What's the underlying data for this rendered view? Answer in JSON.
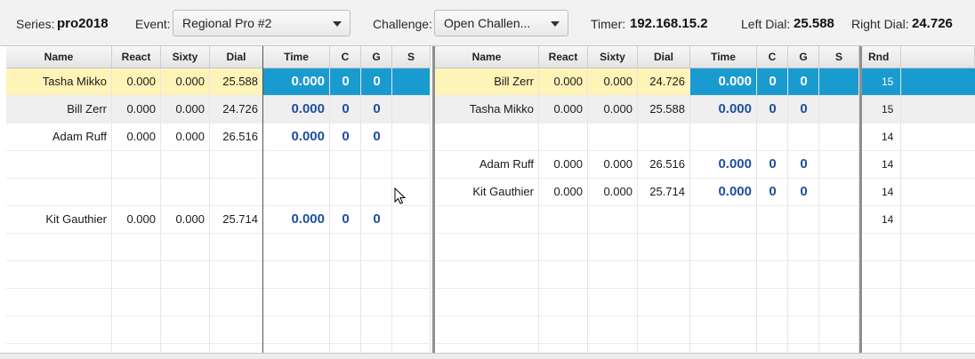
{
  "topbar": {
    "series_label": "Series:",
    "series_value": "pro2018",
    "event_label": "Event:",
    "event_value": "Regional Pro #2",
    "challenge_label": "Challenge:",
    "challenge_value": "Open Challen...",
    "timer_label": "Timer:",
    "timer_value": "192.168.15.2",
    "left_dial_label": "Left Dial:",
    "left_dial_value": "25.588",
    "right_dial_label": "Right Dial:",
    "right_dial_value": "24.726"
  },
  "left_table": {
    "headers": [
      "Name",
      "React",
      "Sixty",
      "Dial",
      "Time",
      "C",
      "G",
      "S"
    ],
    "rows": [
      {
        "name": "Tasha Mikko",
        "react": "0.000",
        "sixty": "0.000",
        "dial": "25.588",
        "time": "0.000",
        "c": "0",
        "g": "0",
        "s": ""
      },
      {
        "name": "Bill Zerr",
        "react": "0.000",
        "sixty": "0.000",
        "dial": "24.726",
        "time": "0.000",
        "c": "0",
        "g": "0",
        "s": ""
      },
      {
        "name": "Adam Ruff",
        "react": "0.000",
        "sixty": "0.000",
        "dial": "26.516",
        "time": "0.000",
        "c": "0",
        "g": "0",
        "s": ""
      },
      {
        "name": "",
        "react": "",
        "sixty": "",
        "dial": "",
        "time": "",
        "c": "",
        "g": "",
        "s": ""
      },
      {
        "name": "",
        "react": "",
        "sixty": "",
        "dial": "",
        "time": "",
        "c": "",
        "g": "",
        "s": ""
      },
      {
        "name": "Kit Gauthier",
        "react": "0.000",
        "sixty": "0.000",
        "dial": "25.714",
        "time": "0.000",
        "c": "0",
        "g": "0",
        "s": ""
      }
    ]
  },
  "right_table": {
    "headers": [
      "Name",
      "React",
      "Sixty",
      "Dial",
      "Time",
      "C",
      "G",
      "S"
    ],
    "rows": [
      {
        "name": "Bill Zerr",
        "react": "0.000",
        "sixty": "0.000",
        "dial": "24.726",
        "time": "0.000",
        "c": "0",
        "g": "0",
        "s": ""
      },
      {
        "name": "Tasha Mikko",
        "react": "0.000",
        "sixty": "0.000",
        "dial": "25.588",
        "time": "0.000",
        "c": "0",
        "g": "0",
        "s": ""
      },
      {
        "name": "",
        "react": "",
        "sixty": "",
        "dial": "",
        "time": "",
        "c": "",
        "g": "",
        "s": ""
      },
      {
        "name": "Adam Ruff",
        "react": "0.000",
        "sixty": "0.000",
        "dial": "26.516",
        "time": "0.000",
        "c": "0",
        "g": "0",
        "s": ""
      },
      {
        "name": "Kit Gauthier",
        "react": "0.000",
        "sixty": "0.000",
        "dial": "25.714",
        "time": "0.000",
        "c": "0",
        "g": "0",
        "s": ""
      },
      {
        "name": "",
        "react": "",
        "sixty": "",
        "dial": "",
        "time": "",
        "c": "",
        "g": "",
        "s": ""
      }
    ]
  },
  "round_table": {
    "header": "Rnd",
    "rows": [
      "15",
      "15",
      "14",
      "14",
      "14",
      "14"
    ]
  },
  "colors": {
    "selected_yellow": "#fff4b8",
    "selected_blue": "#1a9bd0",
    "value_blue": "#1f4f9e"
  }
}
